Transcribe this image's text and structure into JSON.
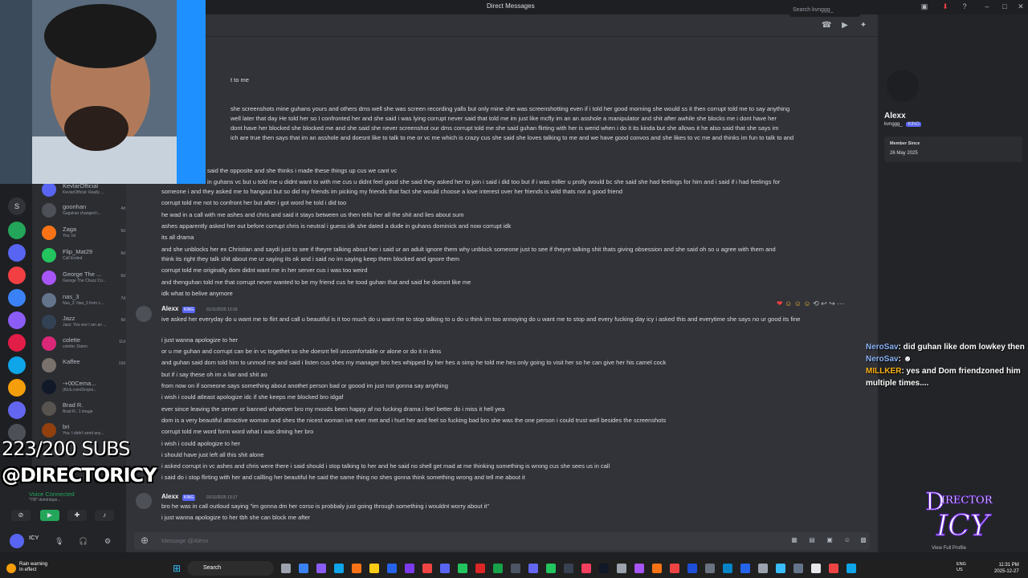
{
  "window": {
    "title": "Direct Messages"
  },
  "search": {
    "placeholder": "Search kvnggg_"
  },
  "dm_list": [
    {
      "name": "KevlarOfficial",
      "sub": "KevlarOfficial: Really ...",
      "time": ""
    },
    {
      "name": "goonhan",
      "sub": "Gagukan changed t...",
      "time": "4d"
    },
    {
      "name": "Zaga",
      "sub": "You: lol",
      "time": "5d"
    },
    {
      "name": "Flip_Mat29",
      "sub": "Call Ended",
      "time": "6d"
    },
    {
      "name": "George The ...",
      "sub": "George The Chuzz Co...",
      "time": "6d"
    },
    {
      "name": "nas_3",
      "sub": "Nas_3: Nas_3 from c...",
      "time": "7d"
    },
    {
      "name": "Jazz",
      "sub": "Jazz: You see I am an ...",
      "time": "9d"
    },
    {
      "name": "colette",
      "sub": "colette: Damn",
      "time": "11d"
    },
    {
      "name": "Kaffee",
      "sub": "",
      "time": "13d"
    },
    {
      "name": "-+00Cema...",
      "sub": "(Kick.com/Dropm...",
      "time": ""
    },
    {
      "name": "Brad R.",
      "sub": "Brad R.: 1 image",
      "time": ""
    },
    {
      "name": "bri",
      "sub": "You: I didn't send any...",
      "time": ""
    }
  ],
  "voice": {
    "status": "Voice Connected",
    "server": "*7/8* dominique..."
  },
  "user": {
    "name": "ICY",
    "status": "S..."
  },
  "messages_top": [
    {
      "text": "t to me"
    },
    {
      "text": "she screenshots mine guhans yours and others dms well she was screen recording yalls but only mine she was screenshotting even if i told her good morning she would ss it then corrupt told me to say anything"
    },
    {
      "text": "well later that day He told her so I confronted her and she said i was lying corrupt never said that told me im just like mcfly im an an asshole a manipulator and shit after awhile she blocks me i dont have her"
    },
    {
      "text": "dont have her blocked she blocked me and she said she never screenshot our dms corrupt told me she said guhan flirting with her is werid when i do it its kinda but she allows it he also said that she says im"
    },
    {
      "text": "ich are true then says that im an asshole and doesnt like to talk to me or vc me which is crazy cus she said she loves talking to me and we have good convos and she likes to vc me and thinks im fun to talk to and"
    },
    {
      "text": "said the opposite and she thinks i made these things up cus we cant vc"
    },
    {
      "text": "in guhans vc but u told me u didnt want to with me cus u didnt feel good she said they asked her to join i said i did too but if i was miller u prolly would bc she said she had feelings for him and i said if i had feelings for"
    },
    {
      "text": "someone i and they asked me to hangout but so did my friends im picking my friends that fact she would choose a love interest over her friends is wild thats not a good friend"
    },
    {
      "text": "corrupt told me not to confront her but after i got word he told i did too"
    },
    {
      "text": "he wad in a call with me ashes and chris and said it stays between us then tells her all the shit and lies about sum"
    },
    {
      "text": "ashes apparently asked her out before corrupt chris is neutral i guess idk she dated a dude in guhans dominick and now corrupt idk"
    },
    {
      "text": "its all drama"
    },
    {
      "text": "and she unblocks her ex Christian and saydi just to see if theyre talking about her i said ur an adult ignore them why unblock someone just to see if theyre talking shit thats giving obsession and she said oh so u agree with them and"
    },
    {
      "text": "think its right they talk shit about me ur saying its ok and i said no im saying keep them blocked and ignore them"
    },
    {
      "text": "corrupt told me originally dom didnt want me in her server cus i was too weird"
    },
    {
      "text": "and thenguhan told me that corrupt never wanted to be my friend cus he tood guhan that and said he doesnt like me"
    },
    {
      "text": "idk what to belive anymore"
    }
  ],
  "message_group_1": {
    "author": "Alexx",
    "badge": "KING",
    "timestamp": "01/11/2025 13:16",
    "lines": [
      "ive asked her everyday do u want me to flirt and call u beautiful is it too much do u want me to stop talking to u do u think im too annoying do u want me to stop and every fucking day icy i asked this and everytime she says no ur good its fine",
      "i just wanna apologize to her",
      "or u me guhan and corrupt can be in vc togethet so she doesnt fell uncomfortable or alone or do it in dms",
      "and guhan said dom told him to unmod me and said i listen cus shes my manager bro hes whipped by her hes a simp he told me hes only going to visit her so he can give her his camel cock",
      "but if i say these oh im a liar and shit ao",
      "from now on if someone says something about anothet person bad or goood im just not gonna say anything",
      "i wish i could atleast apologize idc if she keeps me blocked bro idgaf",
      "ever since leaving the server or banned whatever bro my moods been happy af no fucking drama i feel better do i miss it hell yea",
      "dom is a very beautiful attractive woman and shes the nicest woman ive ever met and i hurt her and feel so fucking bad bro she was the one person i could trust well besides the screenshots",
      "corrupt told me word form word what i was dming her bro",
      "i wish i could apologize to her",
      "i should have just left all this shit alone",
      "i asked corrupt in vc ashes and chris were there i said should i stop talking to her and he said no shell get mad at me thinking something is wrong cus she sees us in call",
      "i said do i stop flirting with her and callling her beautiful he said the same thing no shes gonna think something wrong and tell me about it"
    ]
  },
  "message_group_2": {
    "author": "Alexx",
    "badge": "KING",
    "timestamp": "01/11/2025 13:17",
    "lines": [
      "bro he was in call outloud saying \"im gonna dm her corso is probbaly just going through something i wouldnt worry about it\"",
      "i just wanna apologize to her tbh she can block me after"
    ]
  },
  "composer": {
    "placeholder": "Message @Alexx"
  },
  "profile": {
    "name": "Alexx",
    "username": "kvnggg_",
    "badge": "KING",
    "member_since_label": "Member Since",
    "member_since": "26 May 2025",
    "view_full": "View Full Profile"
  },
  "stream_overlay": {
    "chat": [
      {
        "user": "NeroSav",
        "text": ": did guhan like dom lowkey then"
      },
      {
        "user": "NeroSav",
        "text": ": "
      },
      {
        "user": "MILLKER",
        "text": ": yes and Dom friendzoned him multiple times...."
      }
    ],
    "subs": "223/200 SUBS",
    "handle": "@DIRECTORICY",
    "logo_text": "DIRECTOR ICY"
  },
  "taskbar": {
    "weather_title": "Rain warning",
    "weather_sub": "In effect",
    "search": "Search",
    "lang": "ENG",
    "region": "US",
    "time": "11:31 PM",
    "date": "2025-12-27"
  },
  "colors": {
    "accent": "#5865f2",
    "bg": "#313338",
    "sidebar": "#2b2d31",
    "online": "#23a55a"
  }
}
